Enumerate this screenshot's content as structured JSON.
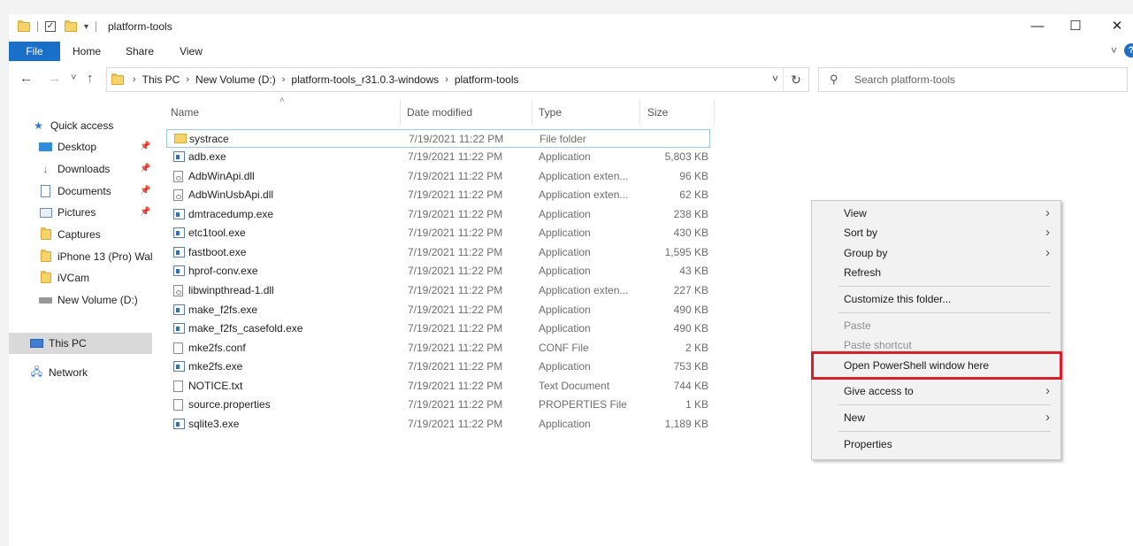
{
  "window": {
    "title": "platform-tools",
    "controls": {
      "minimize": "—",
      "maximize": "☐",
      "close": "✕"
    }
  },
  "ribbon": {
    "tabs": [
      "File",
      "Home",
      "Share",
      "View"
    ],
    "help": "?"
  },
  "nav": {
    "back": "←",
    "forward": "→",
    "recent": "˅",
    "up": "↑",
    "breadcrumb": [
      "This PC",
      "New Volume (D:)",
      "platform-tools_r31.0.3-windows",
      "platform-tools"
    ],
    "refresh": "↻"
  },
  "search": {
    "placeholder": "Search platform-tools"
  },
  "sidebar": {
    "quick_access": "Quick access",
    "items": [
      {
        "label": "Desktop",
        "icon": "desktop-icon",
        "pinned": true
      },
      {
        "label": "Downloads",
        "icon": "downloads-icon",
        "pinned": true
      },
      {
        "label": "Documents",
        "icon": "documents-icon",
        "pinned": true
      },
      {
        "label": "Pictures",
        "icon": "pictures-icon",
        "pinned": true
      },
      {
        "label": "Captures",
        "icon": "folder-icon",
        "pinned": false
      },
      {
        "label": "iPhone 13 (Pro) Wal",
        "icon": "folder-icon",
        "pinned": false
      },
      {
        "label": "iVCam",
        "icon": "folder-icon",
        "pinned": false
      },
      {
        "label": "New Volume (D:)",
        "icon": "drive-icon",
        "pinned": false
      }
    ],
    "this_pc": "This PC",
    "network": "Network"
  },
  "columns": {
    "name": "Name",
    "date": "Date modified",
    "type": "Type",
    "size": "Size"
  },
  "files": [
    {
      "name": "systrace",
      "date": "7/19/2021 11:22 PM",
      "type": "File folder",
      "size": "",
      "icon": "folder"
    },
    {
      "name": "adb.exe",
      "date": "7/19/2021 11:22 PM",
      "type": "Application",
      "size": "5,803 KB",
      "icon": "exe"
    },
    {
      "name": "AdbWinApi.dll",
      "date": "7/19/2021 11:22 PM",
      "type": "Application exten...",
      "size": "96 KB",
      "icon": "dll"
    },
    {
      "name": "AdbWinUsbApi.dll",
      "date": "7/19/2021 11:22 PM",
      "type": "Application exten...",
      "size": "62 KB",
      "icon": "dll"
    },
    {
      "name": "dmtracedump.exe",
      "date": "7/19/2021 11:22 PM",
      "type": "Application",
      "size": "238 KB",
      "icon": "exe"
    },
    {
      "name": "etc1tool.exe",
      "date": "7/19/2021 11:22 PM",
      "type": "Application",
      "size": "430 KB",
      "icon": "exe"
    },
    {
      "name": "fastboot.exe",
      "date": "7/19/2021 11:22 PM",
      "type": "Application",
      "size": "1,595 KB",
      "icon": "exe"
    },
    {
      "name": "hprof-conv.exe",
      "date": "7/19/2021 11:22 PM",
      "type": "Application",
      "size": "43 KB",
      "icon": "exe"
    },
    {
      "name": "libwinpthread-1.dll",
      "date": "7/19/2021 11:22 PM",
      "type": "Application exten...",
      "size": "227 KB",
      "icon": "dll"
    },
    {
      "name": "make_f2fs.exe",
      "date": "7/19/2021 11:22 PM",
      "type": "Application",
      "size": "490 KB",
      "icon": "exe"
    },
    {
      "name": "make_f2fs_casefold.exe",
      "date": "7/19/2021 11:22 PM",
      "type": "Application",
      "size": "490 KB",
      "icon": "exe"
    },
    {
      "name": "mke2fs.conf",
      "date": "7/19/2021 11:22 PM",
      "type": "CONF File",
      "size": "2 KB",
      "icon": "doc"
    },
    {
      "name": "mke2fs.exe",
      "date": "7/19/2021 11:22 PM",
      "type": "Application",
      "size": "753 KB",
      "icon": "exe"
    },
    {
      "name": "NOTICE.txt",
      "date": "7/19/2021 11:22 PM",
      "type": "Text Document",
      "size": "744 KB",
      "icon": "doc"
    },
    {
      "name": "source.properties",
      "date": "7/19/2021 11:22 PM",
      "type": "PROPERTIES File",
      "size": "1 KB",
      "icon": "doc"
    },
    {
      "name": "sqlite3.exe",
      "date": "7/19/2021 11:22 PM",
      "type": "Application",
      "size": "1,189 KB",
      "icon": "exe"
    }
  ],
  "context_menu": {
    "items": [
      {
        "label": "View",
        "submenu": true,
        "disabled": false
      },
      {
        "label": "Sort by",
        "submenu": true,
        "disabled": false
      },
      {
        "label": "Group by",
        "submenu": true,
        "disabled": false
      },
      {
        "label": "Refresh",
        "submenu": false,
        "disabled": false
      },
      {
        "label": "Customize this folder...",
        "submenu": false,
        "disabled": false
      },
      {
        "label": "Paste",
        "submenu": false,
        "disabled": true
      },
      {
        "label": "Paste shortcut",
        "submenu": false,
        "disabled": true
      },
      {
        "label": "Open PowerShell window here",
        "submenu": false,
        "disabled": false,
        "highlighted": true
      },
      {
        "label": "Give access to",
        "submenu": true,
        "disabled": false
      },
      {
        "label": "New",
        "submenu": true,
        "disabled": false
      },
      {
        "label": "Properties",
        "submenu": false,
        "disabled": false
      }
    ],
    "highlight_color": "#d6202a"
  }
}
